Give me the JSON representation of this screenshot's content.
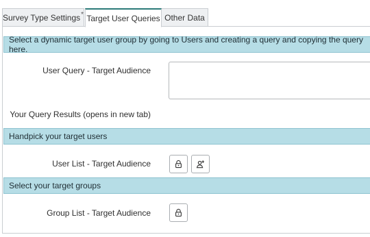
{
  "tabs": [
    {
      "label": "Survey Type Settings",
      "required_mark": "*",
      "active": false
    },
    {
      "label": "Target User Queries",
      "required_mark": "",
      "active": true
    },
    {
      "label": "Other Data",
      "required_mark": "",
      "active": false
    }
  ],
  "sections": {
    "dynamic": {
      "header": "Select a dynamic target user group by going to Users and creating a query and copying the query here.",
      "user_query_label": "User Query - Target Audience",
      "user_query_value": "",
      "results_label": "Your Query Results (opens in new tab)"
    },
    "handpick": {
      "header": "Handpick your target users",
      "user_list_label": "User List - Target Audience",
      "icons": [
        "lock-icon",
        "add-user-icon"
      ]
    },
    "groups": {
      "header": "Select your target groups",
      "group_list_label": "Group List - Target Audience",
      "icons": [
        "lock-icon"
      ]
    }
  },
  "colors": {
    "section_header_bg": "#b6dde6",
    "active_tab_accent": "#2b7a78",
    "border": "#c9cdd1"
  }
}
